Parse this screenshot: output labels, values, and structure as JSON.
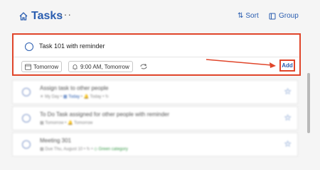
{
  "header": {
    "title": "Tasks",
    "more": "···",
    "sort_label": "Sort",
    "group_label": "Group"
  },
  "new_task": {
    "text": "Task 101 with reminder",
    "due_chip": "Tomorrow",
    "reminder_chip": "9:00 AM, Tomorrow",
    "add_label": "Add"
  },
  "tasks": [
    {
      "title": "Assign task to other people",
      "sub1": "My Day",
      "sub2": "Today",
      "sub3": "Today"
    },
    {
      "title": "To Do Task assigned for other people with reminder",
      "sub1": "Tomorrow",
      "sub2": "Tomorrow"
    },
    {
      "title": "Meeting 301",
      "sub1": "Due Thu, August 10",
      "sub2": "Green category"
    }
  ],
  "colors": {
    "accent": "#2a5db0",
    "highlight": "#e0452a"
  }
}
